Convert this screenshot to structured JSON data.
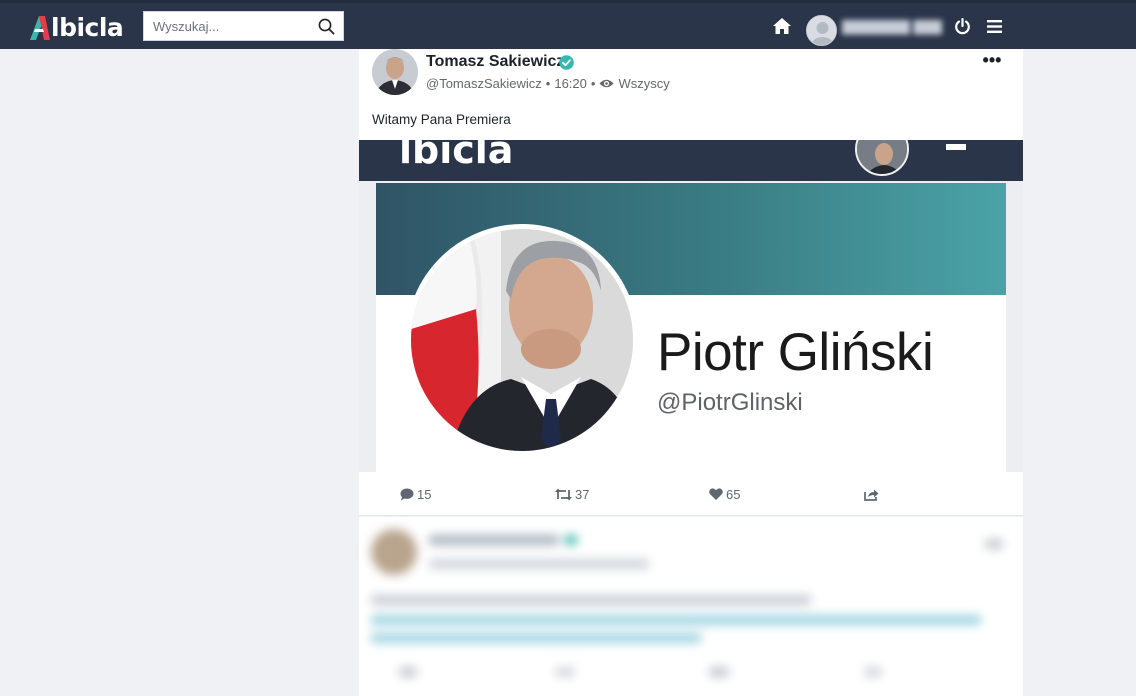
{
  "app": {
    "logo_text": "lbicla",
    "brand_color": "#2a3549",
    "accent_color": "#3bb6ad"
  },
  "search": {
    "placeholder": "Wyszukaj..."
  },
  "nav": {
    "home_icon": "home-icon",
    "power_icon": "power-icon",
    "menu_icon": "hamburger-menu-icon"
  },
  "post": {
    "author_name": "Tomasz Sakiewicz",
    "handle": "@TomaszSakiewicz",
    "time": "16:20",
    "visibility": "Wszyscy",
    "separator": "•",
    "more_label": "•••",
    "text": "Witamy Pana Premiera",
    "embed": {
      "logo_text": "lbicla",
      "profile_name": "Piotr Gliński",
      "profile_handle": "@PiotrGlinski"
    },
    "stats": {
      "comments": "15",
      "reposts": "37",
      "likes": "65"
    }
  }
}
